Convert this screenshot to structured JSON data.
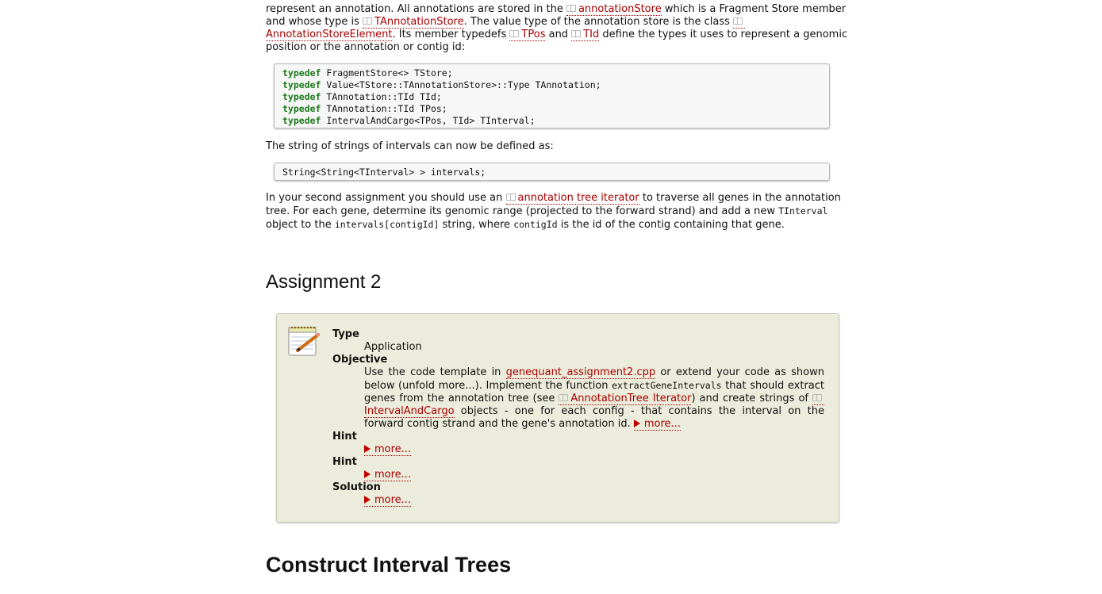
{
  "intro": {
    "t1": "represent an annotation. All annotations are stored in the ",
    "ref_annotationStore": "annotationStore",
    "t2": " which is a Fragment Store member and whose type is ",
    "ref_TAnnotationStore": "TAnnotationStore",
    "t3": ". The value type of the annotation store is the class ",
    "ref_AnnotationStoreElement": "AnnotationStoreElement",
    "t4": ". Its member typedefs ",
    "ref_TPos": "TPos",
    "t5": " and ",
    "ref_TId": "TId",
    "t6": " define the types it uses to represent a genomic position or the annotation or contig id:"
  },
  "code1": {
    "lines": [
      {
        "kw": "typedef",
        "rest": " FragmentStore<> TStore;"
      },
      {
        "kw": "typedef",
        "rest": " Value<TStore::TAnnotationStore>::Type TAnnotation;"
      },
      {
        "kw": "typedef",
        "rest": " TAnnotation::TId TId;"
      },
      {
        "kw": "typedef",
        "rest": " TAnnotation::TId TPos;"
      },
      {
        "kw": "typedef",
        "rest": " IntervalAndCargo<TPos, TId> TInterval;"
      }
    ]
  },
  "para2": "The string of strings of intervals can now be defined as:",
  "code2": "String<String<TInterval> > intervals;",
  "para3": {
    "t1": "In your second assignment you should use an ",
    "ref_iter": "annotation tree iterator",
    "t2": " to traverse all genes in the annotation tree. For each gene, determine its genomic range (projected to the forward strand) and add a new ",
    "c1": "TInterval",
    "t3": " object to the ",
    "c2": "intervals[contigId]",
    "t4": " string, where ",
    "c3": "contigId",
    "t5": " is the id of the contig containing that gene."
  },
  "assignment_heading": "Assignment 2",
  "assignment": {
    "type_label": "Type",
    "type_value": "Application",
    "objective_label": "Objective",
    "obj_t1": "Use the code template in ",
    "obj_link": "genequant_assignment2.cpp",
    "obj_t2": " or extend your code as shown below (unfold more...). Implement the function ",
    "obj_code": "extractGeneIntervals",
    "obj_t3": " that should extract genes from the annotation tree (see ",
    "obj_ref1": "AnnotationTree Iterator",
    "obj_t4": ") and create strings of ",
    "obj_ref2": "IntervalAndCargo",
    "obj_t5": " objects - one for each config - that contains the interval on the forward contig strand and the gene's annotation id. ",
    "more": "more...",
    "hint1_label": "Hint",
    "hint2_label": "Hint",
    "solution_label": "Solution"
  },
  "section_heading": "Construct Interval Trees",
  "colors": {
    "link": "#a80000",
    "keyword": "#1a7a1a",
    "assignment_bg": "#ececdc"
  }
}
